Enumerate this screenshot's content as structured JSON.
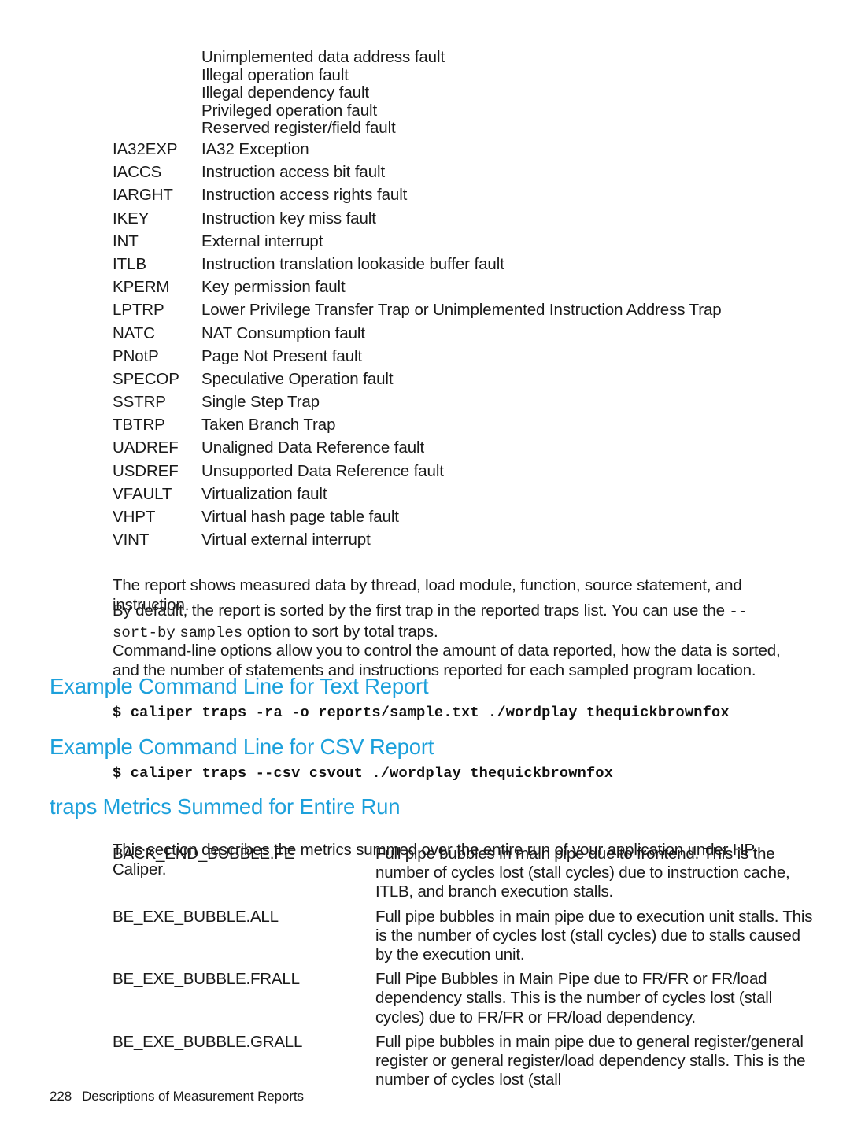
{
  "page": {
    "footer_page_number": "228",
    "footer_title": "Descriptions of Measurement Reports",
    "heading_color": "#1CA0DB"
  },
  "continued_fault_lines": [
    "Unimplemented data address fault",
    "Illegal operation fault",
    "Illegal dependency fault",
    "Privileged operation fault",
    "Reserved register/field fault"
  ],
  "trap_definitions": [
    {
      "term": "IA32EXP",
      "desc": "IA32 Exception"
    },
    {
      "term": "IACCS",
      "desc": "Instruction access bit fault"
    },
    {
      "term": "IARGHT",
      "desc": "Instruction access rights fault"
    },
    {
      "term": "IKEY",
      "desc": "Instruction key miss fault"
    },
    {
      "term": "INT",
      "desc": "External interrupt"
    },
    {
      "term": "ITLB",
      "desc": "Instruction translation lookaside buffer fault"
    },
    {
      "term": "KPERM",
      "desc": "Key permission fault"
    },
    {
      "term": "LPTRP",
      "desc": "Lower Privilege Transfer Trap or Unimplemented Instruction Address Trap"
    },
    {
      "term": "NATC",
      "desc": "NAT Consumption fault"
    },
    {
      "term": "PNotP",
      "desc": "Page Not Present fault"
    },
    {
      "term": "SPECOP",
      "desc": "Speculative Operation fault"
    },
    {
      "term": "SSTRP",
      "desc": "Single Step Trap"
    },
    {
      "term": "TBTRP",
      "desc": "Taken Branch Trap"
    },
    {
      "term": "UADREF",
      "desc": "Unaligned Data Reference fault"
    },
    {
      "term": "USDREF",
      "desc": "Unsupported Data Reference fault"
    },
    {
      "term": "VFAULT",
      "desc": "Virtualization fault"
    },
    {
      "term": "VHPT",
      "desc": "Virtual hash page table fault"
    },
    {
      "term": "VINT",
      "desc": "Virtual external interrupt"
    }
  ],
  "paragraphs": {
    "report_shows": "The report shows measured data by thread, load module, function, source statement, and instruction.",
    "sorted_prefix": "By default, the report is sorted by the first trap in the reported traps list. You can use the ",
    "sorted_option_1": "--sort-by",
    "sorted_option_2": "samples",
    "sorted_suffix": " option to sort by total traps.",
    "command_line_options": "Command-line options allow you to control the amount of data reported, how the data is sorted, and the number of statements and instructions reported for each sampled program location."
  },
  "sections": {
    "text_report_heading": "Example Command Line for Text Report",
    "text_report_command": "$ caliper traps -ra -o reports/sample.txt ./wordplay thequickbrownfox",
    "csv_report_heading": "Example Command Line for CSV Report",
    "csv_report_command": "$ caliper traps --csv csvout ./wordplay thequickbrownfox",
    "metrics_heading": "traps Metrics Summed for Entire Run",
    "metrics_intro": "This section describes the metrics summed over the entire run of your application under HP Caliper."
  },
  "metrics": [
    {
      "term": "BACK_END_BUBBLE.FE",
      "desc": "Full pipe bubbles in main pipe due to frontend. This is the number of cycles lost (stall cycles) due to instruction cache, ITLB, and branch execution stalls."
    },
    {
      "term": "BE_EXE_BUBBLE.ALL",
      "desc": "Full pipe bubbles in main pipe due to execution unit stalls. This is the number of cycles lost (stall cycles) due to stalls caused by the execution unit."
    },
    {
      "term": "BE_EXE_BUBBLE.FRALL",
      "desc": "Full Pipe Bubbles in Main Pipe due to FR/FR or FR/load dependency stalls. This is the number of cycles lost (stall cycles) due to FR/FR or FR/load dependency."
    },
    {
      "term": "BE_EXE_BUBBLE.GRALL",
      "desc": "Full pipe bubbles in main pipe due to general register/general register or general register/load dependency stalls. This is the number of cycles lost (stall"
    }
  ]
}
